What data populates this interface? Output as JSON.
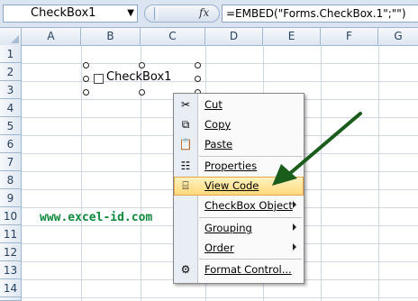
{
  "formula_bar": {
    "name_box": "CheckBox1",
    "name_box_dropdown_icon": "chevron-down-icon",
    "fx_label": "fx",
    "formula": "=EMBED(\"Forms.CheckBox.1\";\"\")"
  },
  "columns": [
    "A",
    "B",
    "C",
    "D",
    "E",
    "F",
    "G"
  ],
  "rows": [
    "1",
    "2",
    "3",
    "4",
    "5",
    "6",
    "7",
    "8",
    "9",
    "10",
    "11",
    "12",
    "13",
    "14"
  ],
  "checkbox": {
    "label": "CheckBox1"
  },
  "context_menu": {
    "items": [
      {
        "label": "Cut",
        "icon": "scissors-icon"
      },
      {
        "label": "Copy",
        "icon": "copy-icon"
      },
      {
        "label": "Paste",
        "icon": "paste-icon"
      },
      {
        "label": "Properties",
        "icon": "properties-icon"
      },
      {
        "label": "View Code",
        "icon": "view-code-icon",
        "highlighted": true
      },
      {
        "label": "CheckBox Object",
        "submenu": true
      },
      {
        "label": "Grouping",
        "submenu": true
      },
      {
        "label": "Order",
        "submenu": true
      },
      {
        "label": "Format Control...",
        "icon": "format-control-icon"
      }
    ]
  },
  "watermark": "www.excel-id.com",
  "colors": {
    "highlight": "#ffd878",
    "arrow": "#1a5c1a",
    "watermark": "#0e8a3d"
  }
}
